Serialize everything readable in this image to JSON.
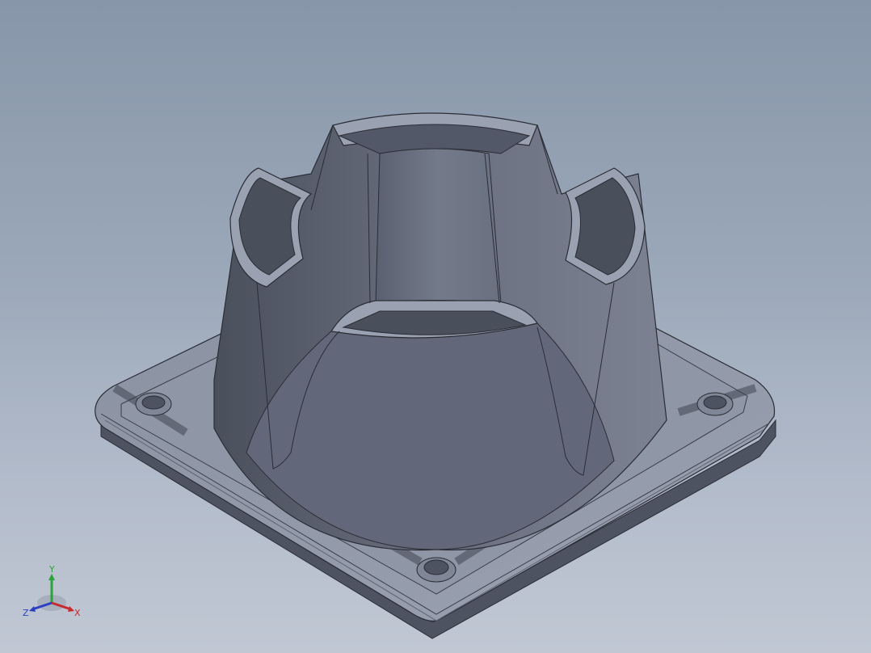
{
  "view": {
    "background_top": "#8796a9",
    "background_bottom": "#c1c8d4",
    "model_color": "#6a7080"
  },
  "triad": {
    "x_label": "X",
    "y_label": "Y",
    "z_label": "Z",
    "x_color": "#c62a2a",
    "y_color": "#2aa33a",
    "z_color": "#2a3fc6"
  }
}
